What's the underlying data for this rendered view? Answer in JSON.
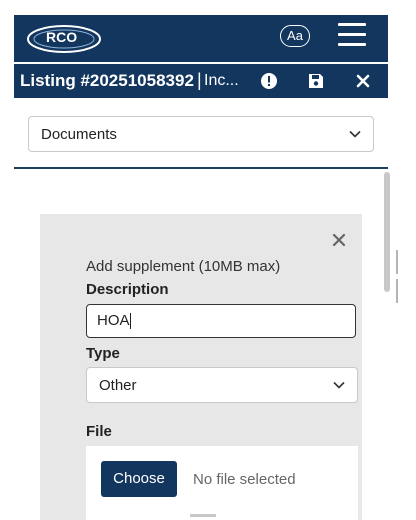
{
  "header": {
    "logo_name": "RCO",
    "text_size_button": "Aa",
    "menu_icon": "hamburger-menu-icon",
    "color": "#13365e"
  },
  "listing": {
    "title": "Listing #20251058392",
    "separator": "|",
    "status": "Inc...",
    "icons": [
      "exclamation-circle-icon",
      "save-icon",
      "close-icon"
    ]
  },
  "section_select": {
    "value": "Documents"
  },
  "supplement": {
    "heading": "Add supplement (10MB max)",
    "description_label": "Description",
    "description_value": "HOA",
    "type_label": "Type",
    "type_value": "Other",
    "file_label": "File",
    "choose_button": "Choose",
    "file_status": "No file selected"
  }
}
